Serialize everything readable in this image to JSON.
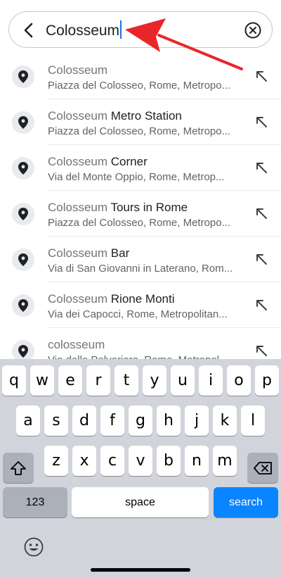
{
  "search": {
    "query": "Colosseum",
    "back_icon": "chevron-left-icon",
    "clear_icon": "clear-circle-icon",
    "annotation_color": "#e8262a",
    "caret_color": "#1a73e8"
  },
  "suggestions": [
    {
      "highlight": "Colosseum",
      "rest": "",
      "subtitle": "Piazza del Colosseo, Rome, Metropo..."
    },
    {
      "highlight": "Colosseum",
      "rest": " Metro Station",
      "subtitle": "Piazza del Colosseo, Rome, Metropo..."
    },
    {
      "highlight": "Colosseum",
      "rest": " Corner",
      "subtitle": "Via del Monte Oppio, Rome, Metrop..."
    },
    {
      "highlight": "Colosseum",
      "rest": " Tours in Rome",
      "subtitle": "Piazza del Colosseo, Rome, Metropo..."
    },
    {
      "highlight": "Colosseum",
      "rest": " Bar",
      "subtitle": "Via di San Giovanni in Laterano, Rom..."
    },
    {
      "highlight": "Colosseum",
      "rest": " Rione Monti",
      "subtitle": "Via dei Capocci, Rome, Metropolitan..."
    },
    {
      "highlight": "colosseum",
      "rest": "",
      "subtitle": "Via delle Polveriere, Rome, Metropol..."
    }
  ],
  "keyboard": {
    "row1": [
      "q",
      "w",
      "e",
      "r",
      "t",
      "y",
      "u",
      "i",
      "o",
      "p"
    ],
    "row2": [
      "a",
      "s",
      "d",
      "f",
      "g",
      "h",
      "j",
      "k",
      "l"
    ],
    "row3": [
      "z",
      "x",
      "c",
      "v",
      "b",
      "n",
      "m"
    ],
    "numbers_label": "123",
    "space_label": "space",
    "search_label": "search",
    "accent_color": "#0a84ff"
  }
}
